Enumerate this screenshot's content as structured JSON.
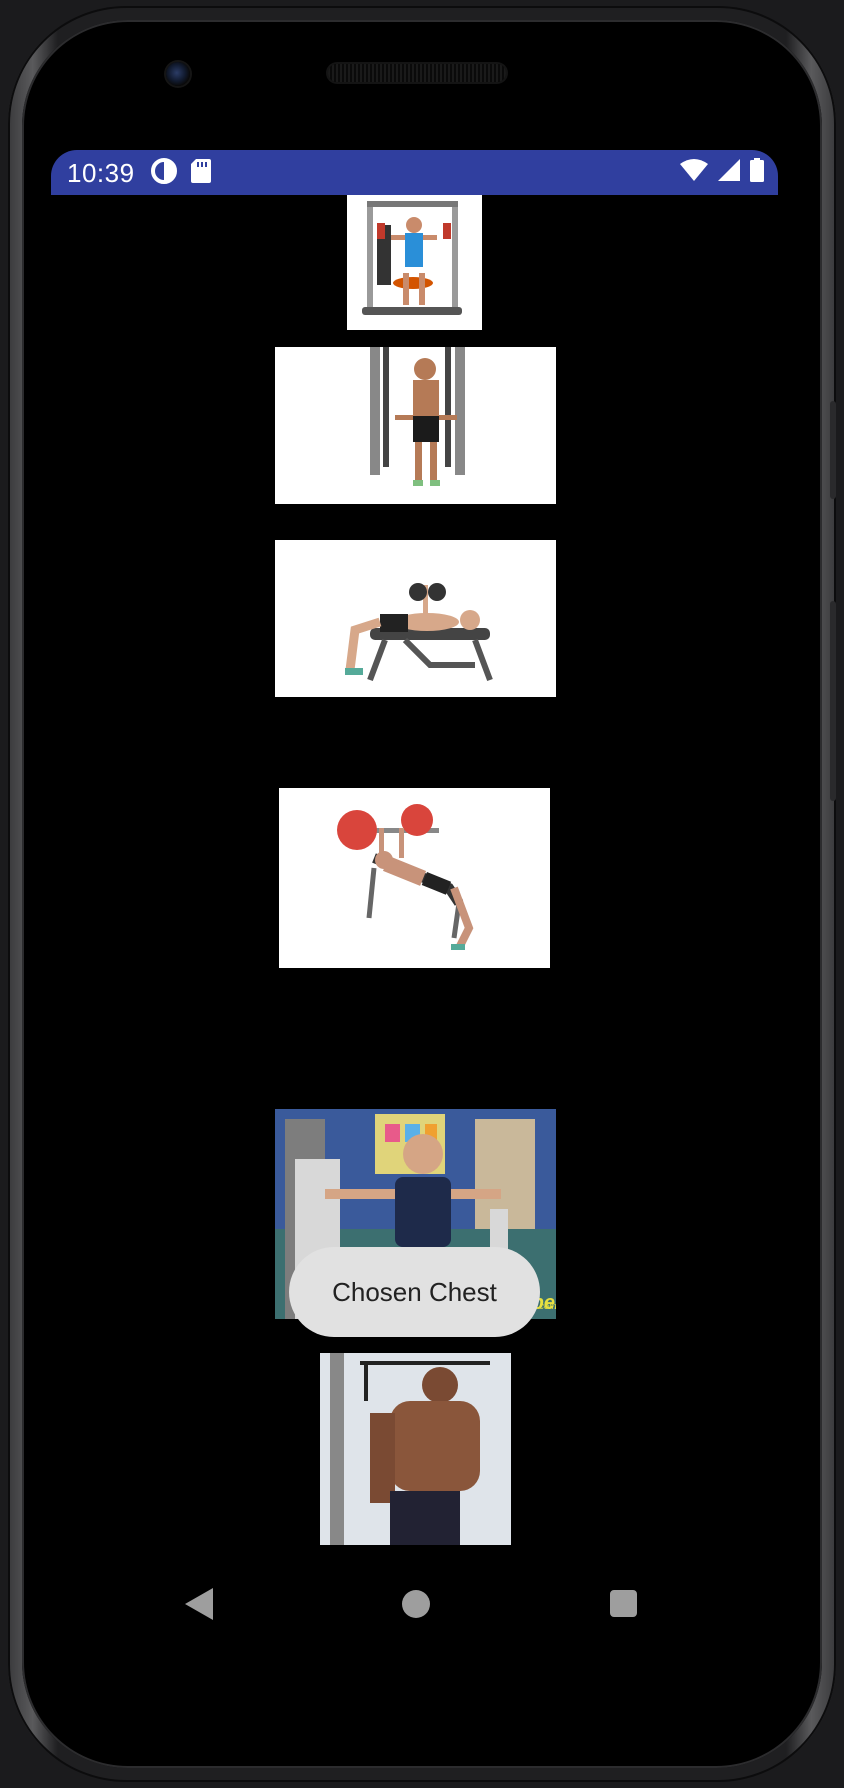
{
  "status_bar": {
    "time": "10:39",
    "left_icons": [
      "data-saver-icon",
      "sd-card-icon"
    ],
    "right_icons": [
      "wifi-icon",
      "cell-signal-icon",
      "battery-icon"
    ],
    "color": "#303f9f"
  },
  "exercises": [
    {
      "icon": "chest-press-machine-image"
    },
    {
      "icon": "cable-crossover-image"
    },
    {
      "icon": "dumbbell-bench-press-image"
    },
    {
      "icon": "incline-barbell-press-image"
    },
    {
      "icon": "seated-chest-press-image",
      "watermark": "ShapeFit.com"
    },
    {
      "icon": "cable-machine-image"
    }
  ],
  "toast": {
    "text": "Chosen Chest"
  },
  "nav_bar": {
    "items": [
      "back-icon",
      "home-icon",
      "recents-icon"
    ]
  }
}
